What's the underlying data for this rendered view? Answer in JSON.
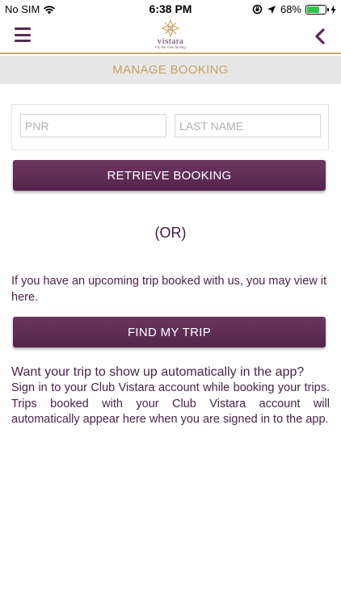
{
  "status_bar": {
    "carrier": "No SIM",
    "time": "6:38 PM",
    "battery_percent": "68%",
    "battery_level": 0.68,
    "battery_color": "#2fc44a"
  },
  "header": {
    "brand": "vistara",
    "tagline": "Fly the new feeling",
    "menu_icon": "hamburger-menu-icon",
    "back_icon": "chevron-left-icon"
  },
  "page": {
    "title": "MANAGE BOOKING"
  },
  "form": {
    "pnr_placeholder": "PNR",
    "pnr_value": "",
    "lastname_placeholder": "LAST NAME",
    "lastname_value": "",
    "retrieve_label": "RETRIEVE BOOKING"
  },
  "divider_text": "(OR)",
  "upcoming": {
    "text": "If you have an upcoming trip booked with us, you may view it here.",
    "find_label": "FIND MY TRIP"
  },
  "auto_trip": {
    "heading": "Want your trip to show up automatically in the app?",
    "body": "Sign in to your Club Vistara account while booking your trips. Trips booked with your Club Vistara account will automatically appear here when you are signed in to the app."
  },
  "colors": {
    "primary": "#5e2c55",
    "gold": "#c3a062",
    "title_bar_bg": "#e8e7e8"
  }
}
